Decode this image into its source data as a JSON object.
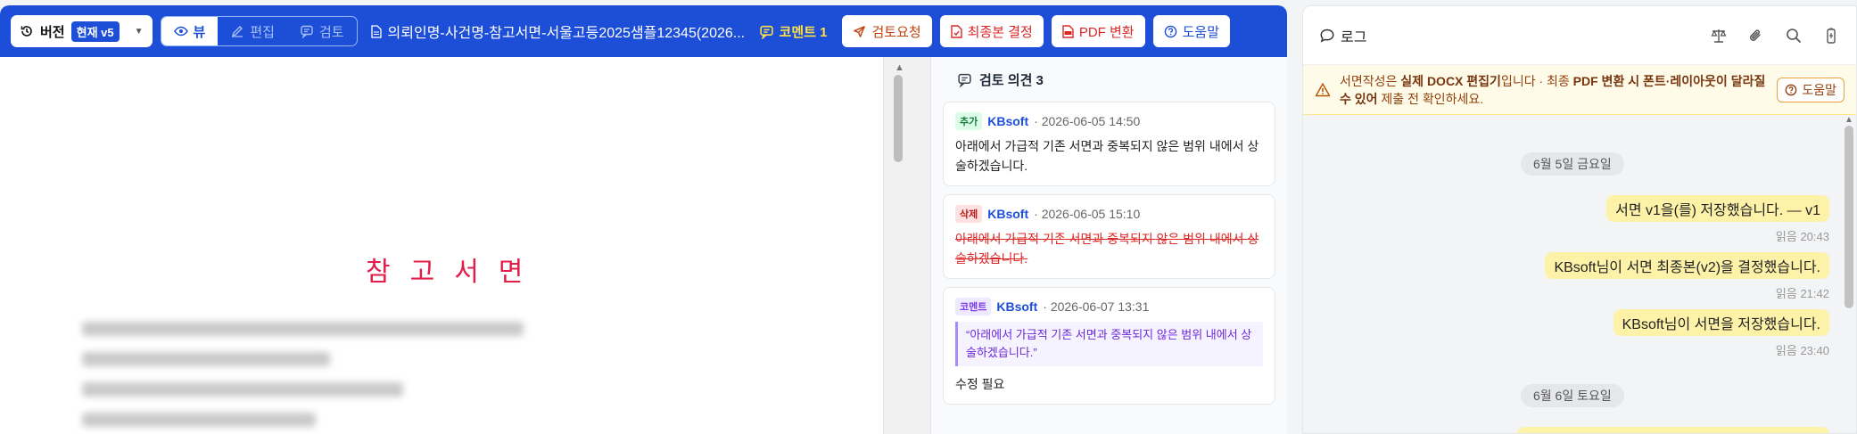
{
  "toolbar": {
    "version_label": "버전",
    "version_badge": "현재 v5",
    "mode_view": "뷰",
    "mode_edit": "편집",
    "mode_review": "검토",
    "doc_title": "의뢰인명-사건명-참고서면-서울고등2025샘플12345(2026...",
    "comment_count": "코멘트 1",
    "review_request": "검토요청",
    "finalize": "최종본 결정",
    "pdf_convert": "PDF 변환",
    "help": "도움말",
    "colors": {
      "bar": "#1d4ed8",
      "accent_yellow": "#fde047"
    }
  },
  "document": {
    "heading": "참고서면"
  },
  "review": {
    "title": "검토 의견 3",
    "items": [
      {
        "tag": "추가",
        "author": "KBsoft",
        "time": "· 2026-06-05 14:50",
        "text": "아래에서 가급적 기존 서면과 중복되지 않은 범위 내에서 상술하겠습니다."
      },
      {
        "tag": "삭제",
        "author": "KBsoft",
        "time": "· 2026-06-05 15:10",
        "text": "아래에서 가급적 기존 서면과 중복되지 않은 범위 내에서 상술하겠습니다."
      },
      {
        "tag": "코멘트",
        "author": "KBsoft",
        "time": "· 2026-06-07 13:31",
        "quote": "“아래에서 가급적 기존 서면과 중복되지 않은 범위 내에서 상술하겠습니다.”",
        "text": "수정 필요"
      }
    ]
  },
  "log": {
    "title": "로그",
    "notice_pre": "서면작성은 ",
    "notice_b1": "실제 DOCX 편집기",
    "notice_mid": "입니다 · 최종 ",
    "notice_b2": "PDF 변환 시 폰트·레이아웃이 달라질 수 있어",
    "notice_post": " 제출 전 확인하세요.",
    "help": "도움말",
    "messages": [
      {
        "date": "6월 5일 금요일"
      },
      {
        "text": "서면 v1을(를) 저장했습니다. — v1",
        "time": "읽음 20:43"
      },
      {
        "text": "KBsoft님이 서면 최종본(v2)을 결정했습니다.",
        "time": "읽음 21:42"
      },
      {
        "text": "KBsoft님이 서면을 저장했습니다.",
        "time": "읽음 23:40"
      },
      {
        "date": "6월 6일 토요일"
      }
    ]
  }
}
